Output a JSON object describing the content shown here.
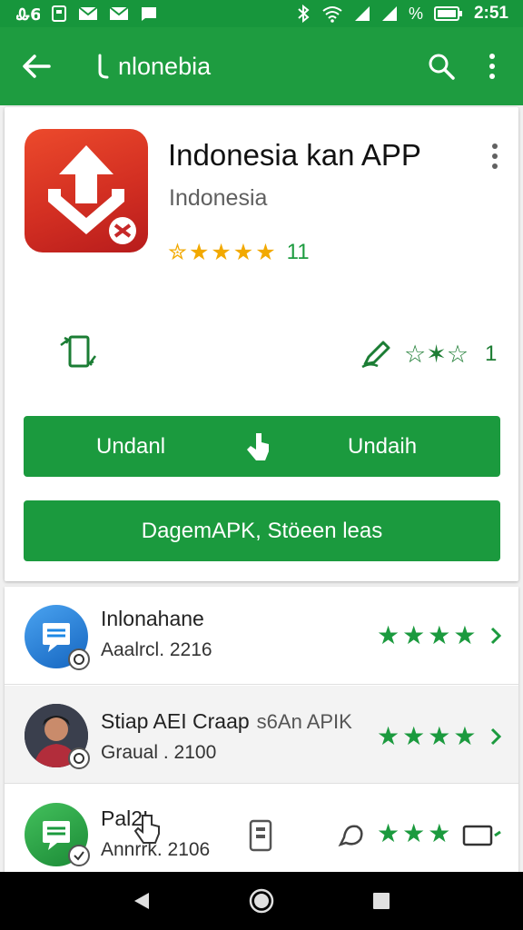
{
  "status_bar": {
    "time": "2:51",
    "left_icons": [
      "signal-icon",
      "sim-icon",
      "mail-icon",
      "mail-icon",
      "message-icon"
    ],
    "right_icons": [
      "bluetooth-icon",
      "wifi-icon",
      "cell-signal-icon",
      "cell-signal-icon",
      "percent-icon",
      "battery-icon"
    ],
    "percent_glyph": "%"
  },
  "toolbar": {
    "search_query": "nlonebia"
  },
  "app": {
    "title": "Indonesia kan APP",
    "publisher": "Indonesia",
    "rating_stars": 5,
    "rating_count": "11",
    "outline_stars": "☆✶☆",
    "outline_count": "1",
    "buttons": {
      "primary_left": "Undanl",
      "primary_right": "Undaih",
      "secondary": "DagemAPK, Stöeen leas"
    },
    "colors": {
      "accent": "#1b9a3e",
      "star": "#f2a900",
      "icon_red": "#d32f22"
    }
  },
  "list": [
    {
      "title": "Inlonahane",
      "subtitle": "Aaalrcl. 2216",
      "stars": 4,
      "avatar": "blue-message-icon"
    },
    {
      "title": "Stiap AEI Craap",
      "extra": "s6An APIK",
      "subtitle": "Graual . 2100",
      "stars": 4,
      "avatar": "person-photo"
    },
    {
      "title": "Pal2I",
      "subtitle": "Annrrk. 2106",
      "stars": 3,
      "avatar": "green-message-icon"
    }
  ],
  "nav": [
    "back-icon",
    "home-icon",
    "recents-icon"
  ]
}
